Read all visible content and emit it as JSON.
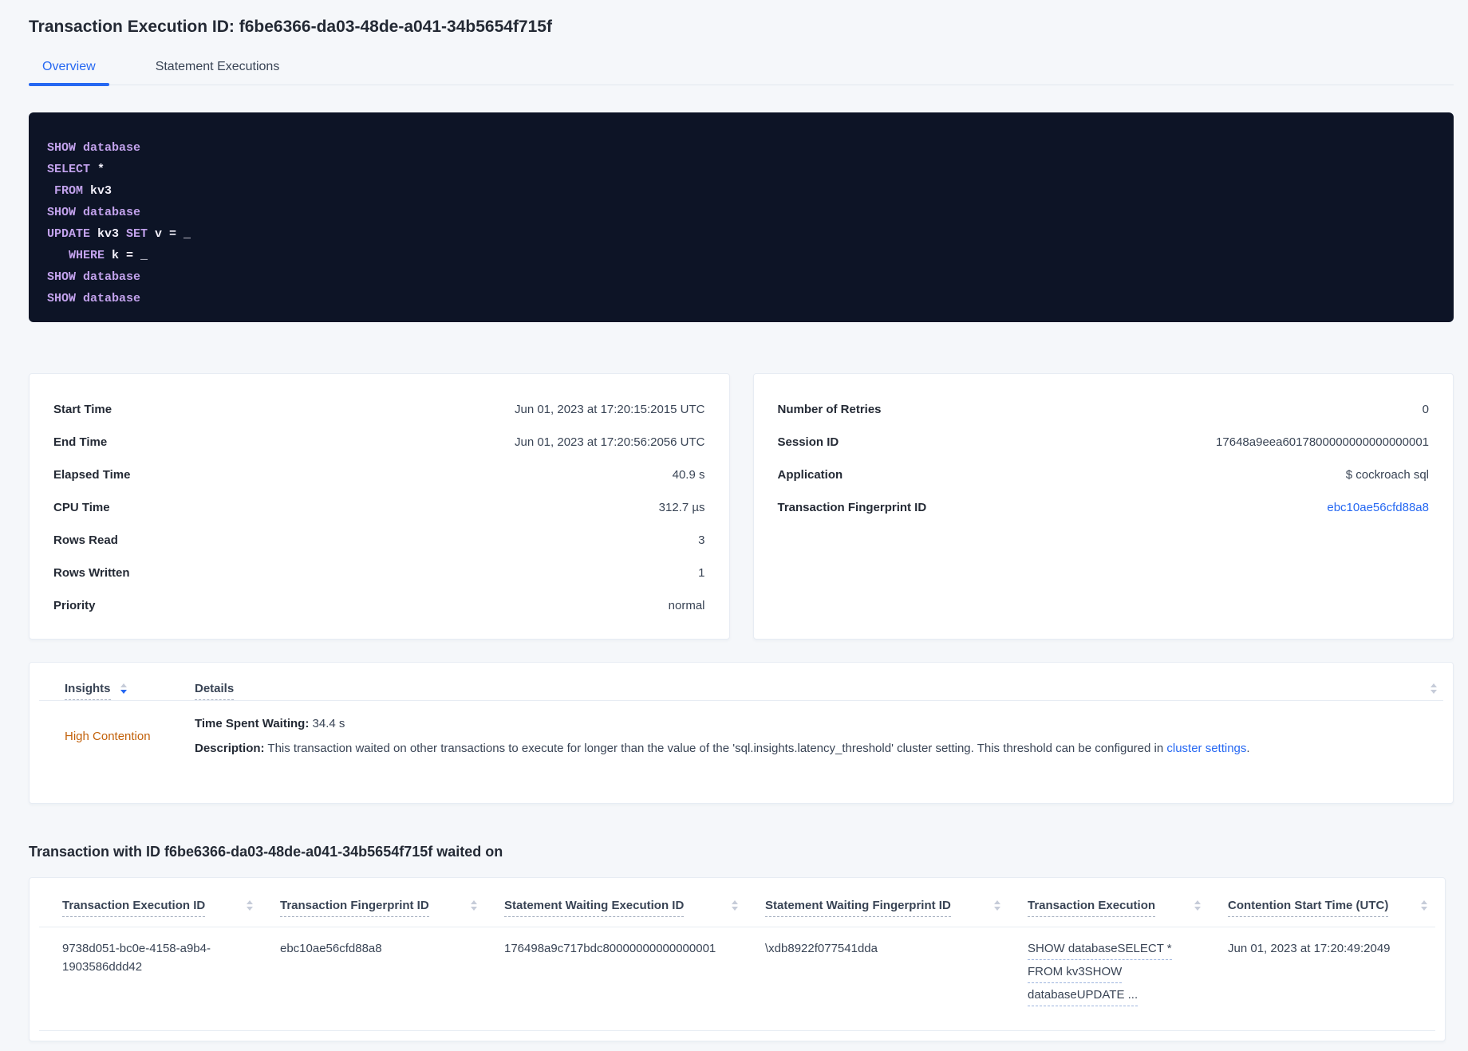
{
  "page": {
    "title": "Transaction Execution ID: f6be6366-da03-48de-a041-34b5654f715f"
  },
  "tabs": {
    "overview": "Overview",
    "statement_executions": "Statement Executions"
  },
  "sql": {
    "lines": [
      [
        {
          "c": "kw",
          "t": "SHOW database"
        }
      ],
      [
        {
          "c": "kw",
          "t": "SELECT"
        },
        {
          "c": "pl",
          "t": " *"
        }
      ],
      [
        {
          "c": "kw",
          "t": " FROM"
        },
        {
          "c": "pl",
          "t": " kv3"
        }
      ],
      [
        {
          "c": "kw",
          "t": "SHOW database"
        }
      ],
      [
        {
          "c": "kw",
          "t": "UPDATE"
        },
        {
          "c": "pl",
          "t": " kv3 "
        },
        {
          "c": "kw",
          "t": "SET"
        },
        {
          "c": "pl",
          "t": " v = _"
        }
      ],
      [
        {
          "c": "kw",
          "t": "   WHERE"
        },
        {
          "c": "pl",
          "t": " k = _"
        }
      ],
      [
        {
          "c": "kw",
          "t": "SHOW database"
        }
      ],
      [
        {
          "c": "kw",
          "t": "SHOW database"
        }
      ]
    ]
  },
  "stats_left": {
    "rows": [
      {
        "label": "Start Time",
        "value": "Jun 01, 2023 at 17:20:15:2015 UTC"
      },
      {
        "label": "End Time",
        "value": "Jun 01, 2023 at 17:20:56:2056 UTC"
      },
      {
        "label": "Elapsed Time",
        "value": "40.9 s"
      },
      {
        "label": "CPU Time",
        "value": "312.7 µs"
      },
      {
        "label": "Rows Read",
        "value": "3"
      },
      {
        "label": "Rows Written",
        "value": "1"
      },
      {
        "label": "Priority",
        "value": "normal"
      }
    ]
  },
  "stats_right": {
    "rows": [
      {
        "label": "Number of Retries",
        "value": "0"
      },
      {
        "label": "Session ID",
        "value": "17648a9eea6017800000000000000001"
      },
      {
        "label": "Application",
        "value": "$ cockroach sql"
      },
      {
        "label": "Transaction Fingerprint ID",
        "value": "ebc10ae56cfd88a8",
        "link": true
      }
    ]
  },
  "insights": {
    "col_insights": "Insights",
    "col_details": "Details",
    "row": {
      "insight": "High Contention",
      "waiting_label": "Time Spent Waiting:",
      "waiting_value": " 34.4 s",
      "desc_label": "Description:",
      "desc_text": " This transaction waited on other transactions to execute for longer than the value of the 'sql.insights.latency_threshold' cluster setting. This threshold can be configured in ",
      "desc_link": "cluster settings",
      "desc_suffix": "."
    }
  },
  "waited": {
    "heading": "Transaction with ID f6be6366-da03-48de-a041-34b5654f715f waited on",
    "columns": [
      "Transaction Execution ID",
      "Transaction Fingerprint ID",
      "Statement Waiting Execution ID",
      "Statement Waiting Fingerprint ID",
      "Transaction Execution",
      "Contention Start Time (UTC)"
    ],
    "row": {
      "txn_execution_id": "9738d051-bc0e-4158-a9b4-1903586ddd42",
      "txn_fingerprint_id": "ebc10ae56cfd88a8",
      "stmt_waiting_execution_id": "176498a9c717bdc80000000000000001",
      "stmt_waiting_fingerprint_id": "\\xdb8922f077541dda",
      "txn_execution_lines": [
        "SHOW databaseSELECT *",
        "FROM kv3SHOW",
        "databaseUPDATE ..."
      ],
      "contention_start": "Jun 01, 2023 at 17:20:49:2049"
    }
  },
  "colors": {
    "accent_blue": "#2668F2",
    "insight_orange": "#C2610A",
    "code_background": "#0D1426",
    "code_keyword": "#C2A2EC",
    "page_background": "#F5F7FA"
  }
}
